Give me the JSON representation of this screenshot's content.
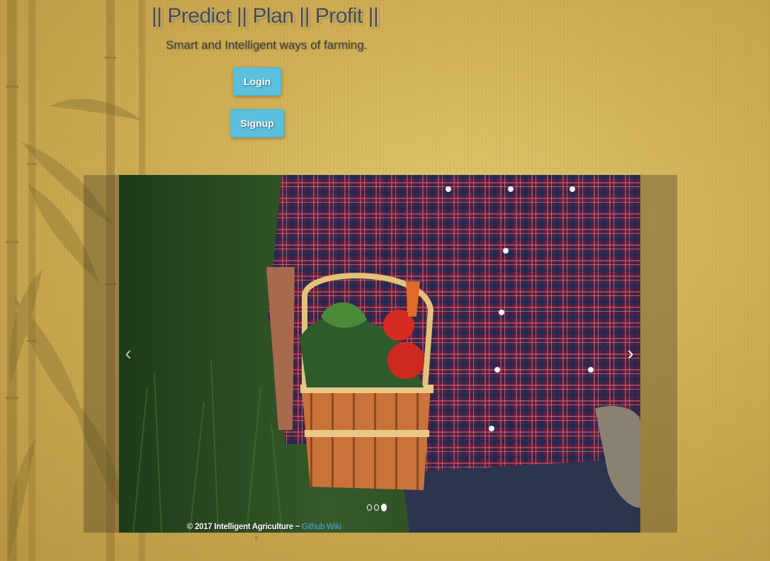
{
  "header": {
    "title": "|| Predict || Plan || Profit ||",
    "subtitle": "Smart and Intelligent ways of farming."
  },
  "actions": {
    "login_label": "Login",
    "signup_label": "Signup"
  },
  "carousel": {
    "prev_icon": "chevron-left-icon",
    "next_icon": "chevron-right-icon",
    "prev_glyph": "‹",
    "next_glyph": "›",
    "slide_count": 3,
    "active_slide": 3,
    "slide_description_icon": "farmer-with-vegetable-basket"
  },
  "footer": {
    "copyright": "© 2017 Intelligent Agriculture ~ ",
    "link_label": "Github Wiki",
    "mark": "?"
  },
  "colors": {
    "button": "#5bc0de",
    "link": "#4ea3e0",
    "background": "#c9a94e"
  }
}
